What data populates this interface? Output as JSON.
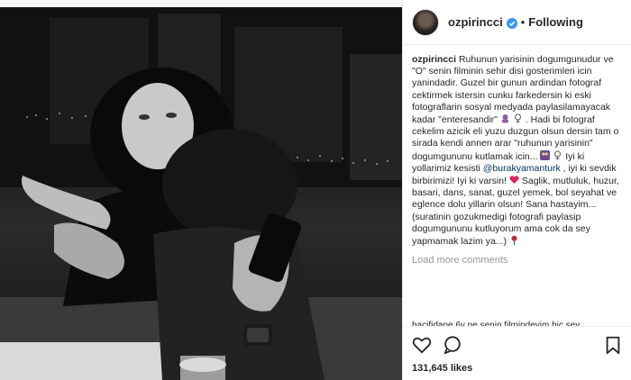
{
  "post": {
    "username": "ozpirincci",
    "follow_status": "Following",
    "separator": "•",
    "caption_parts": {
      "p1": "Ruhunun yarisinin dogumgunudur ve \"O\" senin filminin sehir disi gosterimleri icin yanindadir. Guzel bir gunun ardindan fotograf cektirmek istersin cunku farkedersin ki eski fotograflarin sosyal medyada paylasilamayacak kadar \"enteresandir\"",
      "p2": ". Hadi bi fotograf cekelim azicik eli yuzu duzgun olsun dersin tam o sirada kendi annen arar \"ruhunun yarisinin\" dogumgununu kutlamak icin...",
      "p3": "Iyi ki yollarimiz kesisti",
      "mention": "@burakyamanturk",
      "p4": ", iyi ki sevdik birbirimizi! Iyi ki varsin!",
      "p5": "Saglik, mutluluk, huzur, basari, dans, sanat, guzel yemek, bol seyahat ve eglence dolu yillarin olsun! Sana hastayim... (suratinin gozukmedigi fotografi paylasip dogumgununu kutluyorum ama cok da sey yapmamak lazim ya...)"
    },
    "load_more": "Load more comments",
    "comment_peek": "hacifidane 6y ne senin filmindeyim hic sey",
    "likes": "131,645 likes"
  },
  "icons": {
    "verified": "verified-badge-icon",
    "like": "heart-icon",
    "comment": "comment-icon",
    "save": "bookmark-icon"
  },
  "colors": {
    "accent_verified": "#3897f0",
    "mention": "#003569",
    "heart_emoji": "#e0245e",
    "muted": "#999999"
  }
}
